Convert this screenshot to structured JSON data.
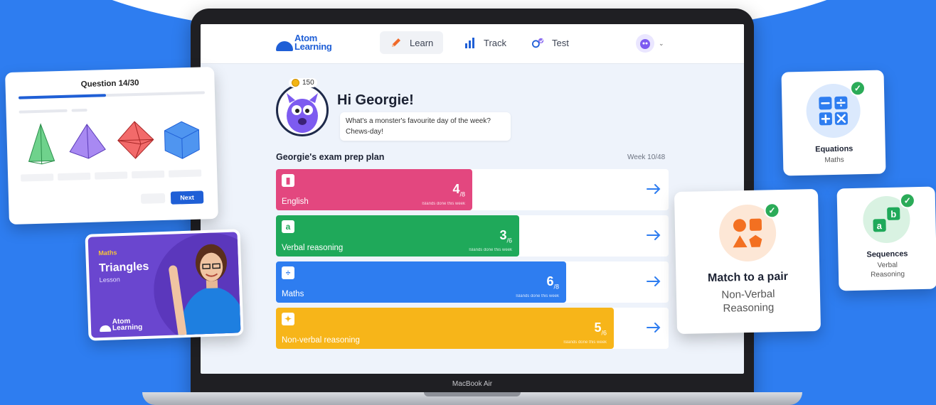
{
  "nav": {
    "logo_line1": "Atom",
    "logo_line2": "Learning",
    "items": [
      {
        "label": "Learn",
        "icon": "pencil-icon"
      },
      {
        "label": "Track",
        "icon": "bar-chart-icon"
      },
      {
        "label": "Test",
        "icon": "test-icon"
      }
    ]
  },
  "profile": {
    "coins": "150",
    "greeting": "Hi Georgie!",
    "joke_line1": "What's a monster's favourite day of the week?",
    "joke_line2": "Chews-day!"
  },
  "plan": {
    "title": "Georgie's exam prep plan",
    "week": "Week 10/48",
    "islands_label": "Islands done this week",
    "subjects": [
      {
        "name": "English",
        "done": "4",
        "total": "/8",
        "progress": 0.5,
        "color": "#e3477f",
        "icon": "book-icon",
        "glyph": "▮"
      },
      {
        "name": "Verbal reasoning",
        "done": "3",
        "total": "/6",
        "progress": 0.62,
        "color": "#1fa95a",
        "icon": "letter-a-icon",
        "glyph": "a"
      },
      {
        "name": "Maths",
        "done": "6",
        "total": "/8",
        "progress": 0.74,
        "color": "#2e7df0",
        "icon": "divide-icon",
        "glyph": "÷"
      },
      {
        "name": "Non-verbal reasoning",
        "done": "5",
        "total": "/6",
        "progress": 0.86,
        "color": "#f7b519",
        "icon": "puzzle-icon",
        "glyph": "✦"
      }
    ]
  },
  "question_card": {
    "title": "Question 14/30",
    "progress": 0.47,
    "next_label": "Next"
  },
  "lesson_card": {
    "subject": "Maths",
    "title": "Triangles",
    "type": "Lesson",
    "logo_line1": "Atom",
    "logo_line2": "Learning"
  },
  "topic_cards": [
    {
      "title": "Equations",
      "subject": "Maths",
      "icon": "calculator-icon"
    },
    {
      "title": "Match to a pair",
      "subject_line1": "Non-Verbal",
      "subject_line2": "Reasoning",
      "icon": "shapes-icon"
    },
    {
      "title": "Sequences",
      "subject_line1": "Verbal",
      "subject_line2": "Reasoning",
      "icon": "ab-sequence-icon"
    }
  ],
  "laptop_label": "MacBook Air"
}
